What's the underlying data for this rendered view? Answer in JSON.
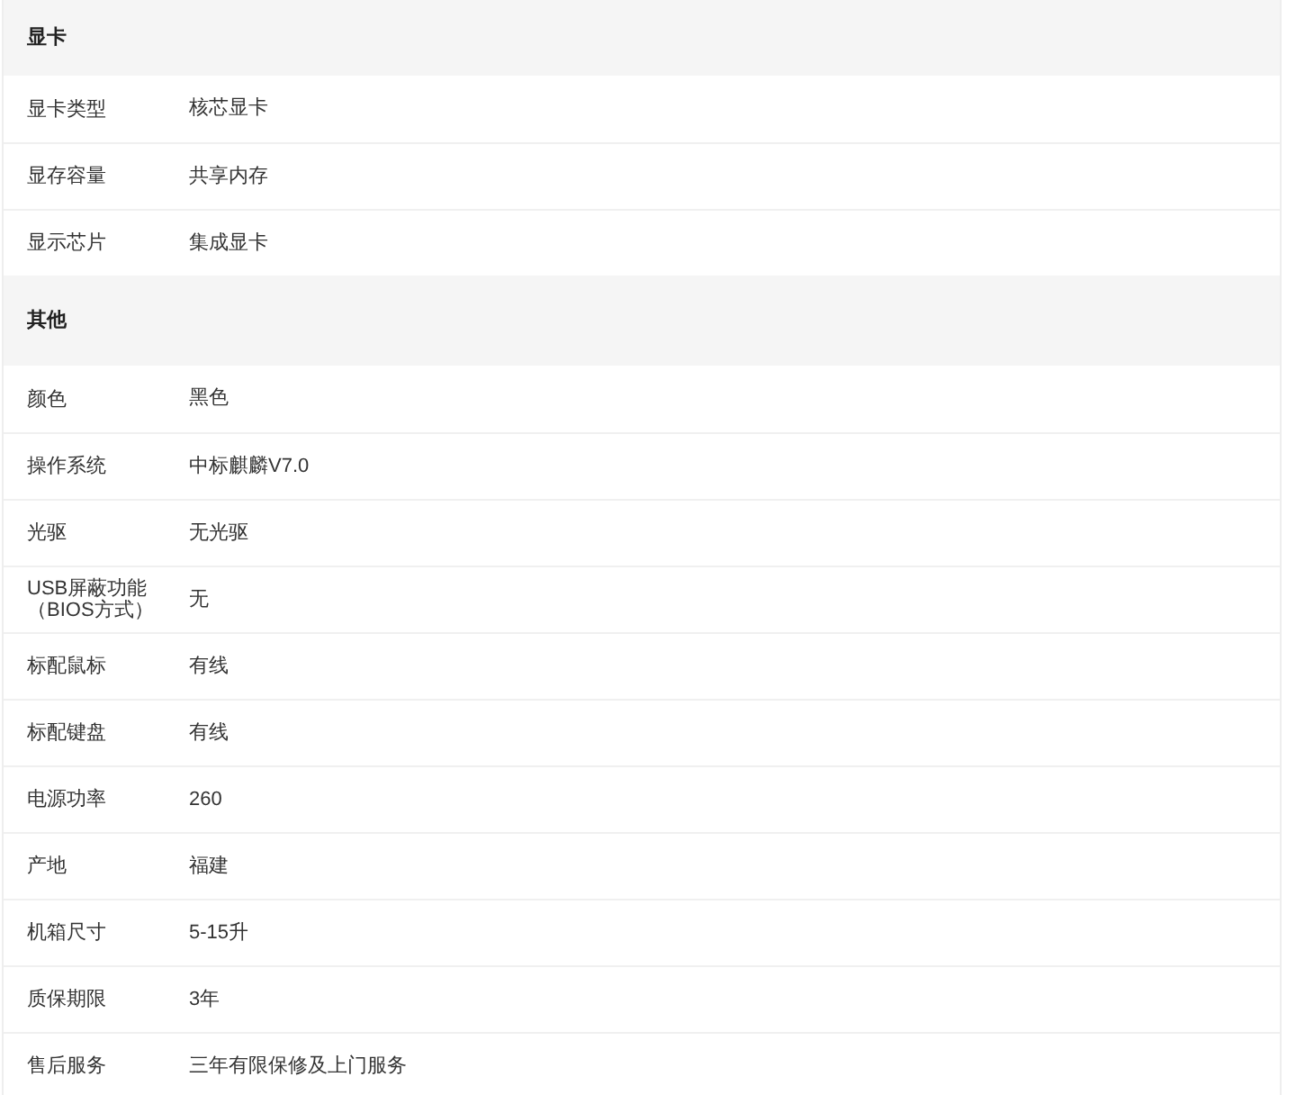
{
  "sections": [
    {
      "title": "显卡",
      "rows": [
        {
          "label": "显卡类型",
          "value": "核芯显卡"
        },
        {
          "label": "显存容量",
          "value": "共享内存"
        },
        {
          "label": "显示芯片",
          "value": "集成显卡"
        }
      ]
    },
    {
      "title": "其他",
      "rows": [
        {
          "label": "颜色",
          "value": "黑色"
        },
        {
          "label": "操作系统",
          "value": "中标麒麟V7.0"
        },
        {
          "label": "光驱",
          "value": "无光驱"
        },
        {
          "label": "USB屏蔽功能（BIOS方式）",
          "value": "无"
        },
        {
          "label": "标配鼠标",
          "value": "有线"
        },
        {
          "label": "标配键盘",
          "value": "有线"
        },
        {
          "label": "电源功率",
          "value": "260"
        },
        {
          "label": "产地",
          "value": "福建"
        },
        {
          "label": "机箱尺寸",
          "value": "5-15升"
        },
        {
          "label": "质保期限",
          "value": "3年"
        },
        {
          "label": "售后服务",
          "value": "三年有限保修及上门服务"
        }
      ]
    }
  ]
}
